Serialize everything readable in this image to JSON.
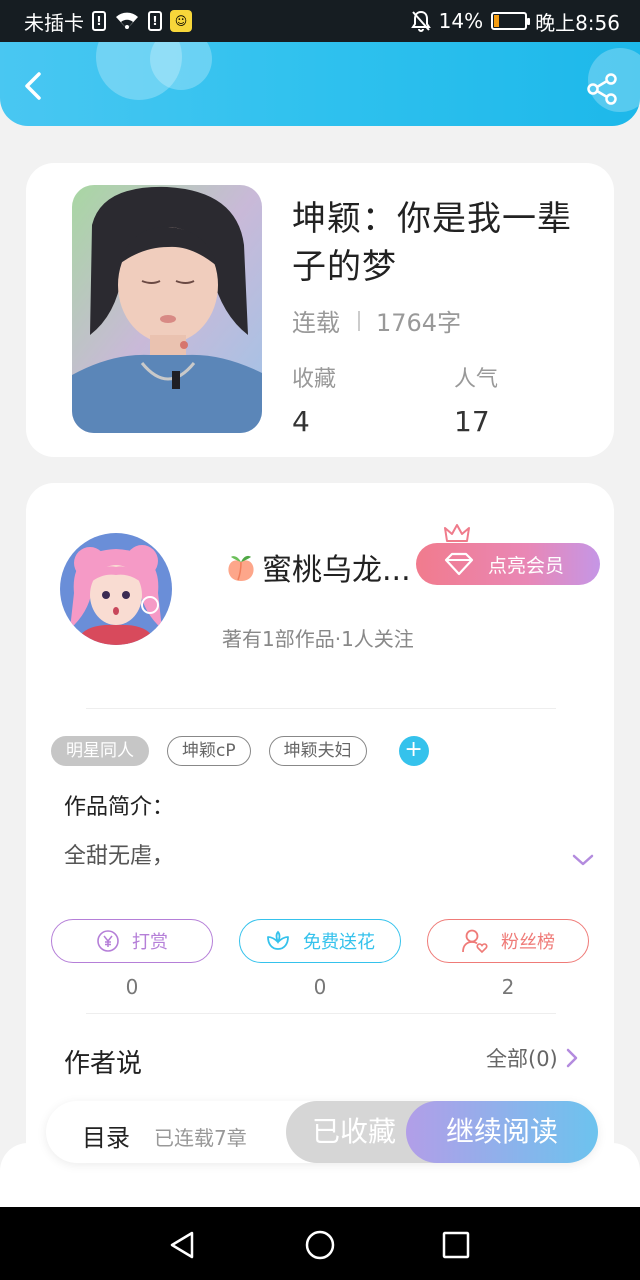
{
  "status_bar": {
    "carrier": "未插卡",
    "sim_glyph": "!",
    "app_glyph": "☺",
    "battery_percent": "14%",
    "battery_level": 0.14,
    "time": "晚上8:56"
  },
  "header": {
    "back_icon": "chevron-left-icon",
    "share_icon": "share-icon"
  },
  "book": {
    "title": "坤颖：你是我一辈子的梦",
    "status": "连载",
    "word_count": "1764字",
    "stats": [
      {
        "label": "收藏",
        "value": "4"
      },
      {
        "label": "人气",
        "value": "17"
      }
    ]
  },
  "author": {
    "name": "蜜桃乌龙...",
    "vip_label": "点亮会员",
    "stats_text": "著有1部作品·1人关注"
  },
  "tags": [
    "明星同人",
    "坤颖cP",
    "坤颖夫妇"
  ],
  "tag_add": "+",
  "intro": {
    "title": "作品简介：",
    "text": "全甜无虐，"
  },
  "actions": [
    {
      "label": "打赏",
      "count": "0",
      "icon": "yen-icon",
      "color": "#b57fd8"
    },
    {
      "label": "免费送花",
      "count": "0",
      "icon": "flower-icon",
      "color": "#35c2ec"
    },
    {
      "label": "粉丝榜",
      "count": "2",
      "icon": "fans-icon",
      "color": "#ef7b78"
    }
  ],
  "author_says": {
    "title": "作者说",
    "view_all": "全部(0)"
  },
  "bottom_bar": {
    "catalog": "目录",
    "chapters": "已连载7章",
    "collected": "已收藏",
    "continue_reading": "继续阅读"
  },
  "colors": {
    "header_accent": "#2fc1ee",
    "vip_gradient_start": "#f17b8d",
    "vip_gradient_end": "#c596e6"
  }
}
